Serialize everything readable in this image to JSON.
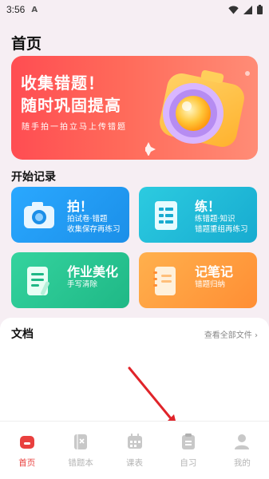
{
  "status": {
    "time": "3:56",
    "indicator": "A",
    "icons": [
      "wifi-icon",
      "signal-icon",
      "battery-icon"
    ]
  },
  "header": {
    "title": "首页"
  },
  "banner": {
    "line1": "收集错题！",
    "line2": "随时巩固提高",
    "subtitle": "随手拍一拍立马上传错题"
  },
  "section": {
    "title": "开始记录"
  },
  "cards": [
    {
      "title": "拍！",
      "line1": "拍试卷·错题",
      "line2": "收集保存再练习",
      "color": "#1f9cf0"
    },
    {
      "title": "练！",
      "line1": "练错题·知识",
      "line2": "错题重组再练习",
      "color": "#1eb9d4"
    },
    {
      "title": "作业美化",
      "line1": "手写清除",
      "line2": "",
      "color": "#27c493"
    },
    {
      "title": "记笔记",
      "line1": "错题归纳",
      "line2": "",
      "color": "#ff9a3c"
    }
  ],
  "docs": {
    "title": "文档",
    "link": "查看全部文件"
  },
  "tabs": [
    {
      "label": "首页",
      "icon": "home-icon",
      "active": true
    },
    {
      "label": "错题本",
      "icon": "wrongbook-icon",
      "active": false
    },
    {
      "label": "课表",
      "icon": "calendar-icon",
      "active": false
    },
    {
      "label": "自习",
      "icon": "clipboard-icon",
      "active": false
    },
    {
      "label": "我的",
      "icon": "profile-icon",
      "active": false
    }
  ],
  "colors": {
    "accent": "#e9403e",
    "background": "#f6eef3"
  }
}
